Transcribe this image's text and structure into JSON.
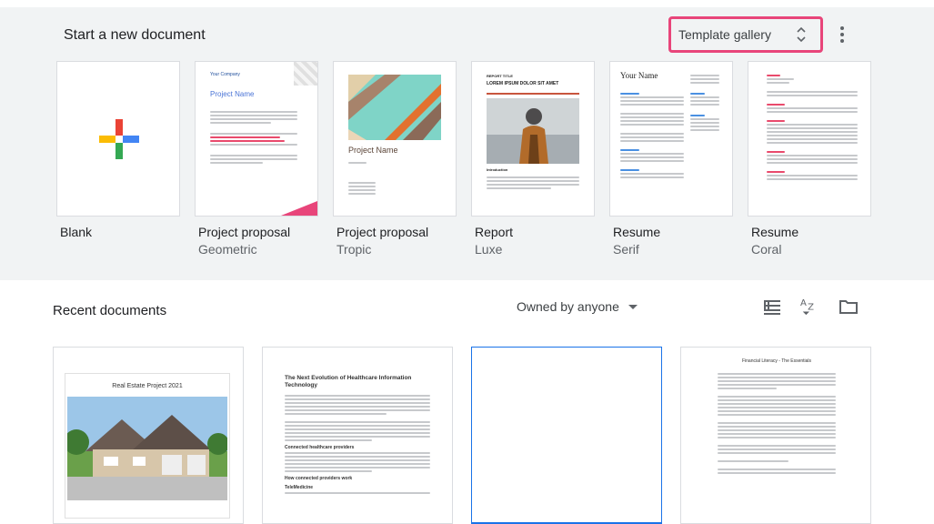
{
  "header": {
    "title": "Start a new document",
    "gallery_label": "Template gallery"
  },
  "templates": [
    {
      "name": "Blank",
      "sub": ""
    },
    {
      "name": "Project proposal",
      "sub": "Geometric",
      "company": "Your Company",
      "project": "Project Name"
    },
    {
      "name": "Project proposal",
      "sub": "Tropic",
      "project": "Project Name"
    },
    {
      "name": "Report",
      "sub": "Luxe",
      "heading": "REPORT TITLE",
      "subheading": "LOREM IPSUM DOLOR SIT AMET",
      "intro": "Introduction"
    },
    {
      "name": "Resume",
      "sub": "Serif",
      "your_name": "Your Name"
    },
    {
      "name": "Resume",
      "sub": "Coral"
    }
  ],
  "recent": {
    "title": "Recent documents",
    "owner_filter": "Owned by anyone"
  },
  "docs": [
    {
      "title": "Real Estate Project 2021"
    },
    {
      "title": "The Next Evolution of Healthcare Information Technology",
      "h1": "Connected healthcare providers",
      "h2": "How connected providers work",
      "h3": "TeleMedicine"
    },
    {
      "title": ""
    },
    {
      "title": "Financial Literacy - The Essentials"
    }
  ],
  "colors": {
    "accent_blue": "#1a73e8",
    "highlight": "#e8457a",
    "top_bg": "#f1f3f4"
  }
}
